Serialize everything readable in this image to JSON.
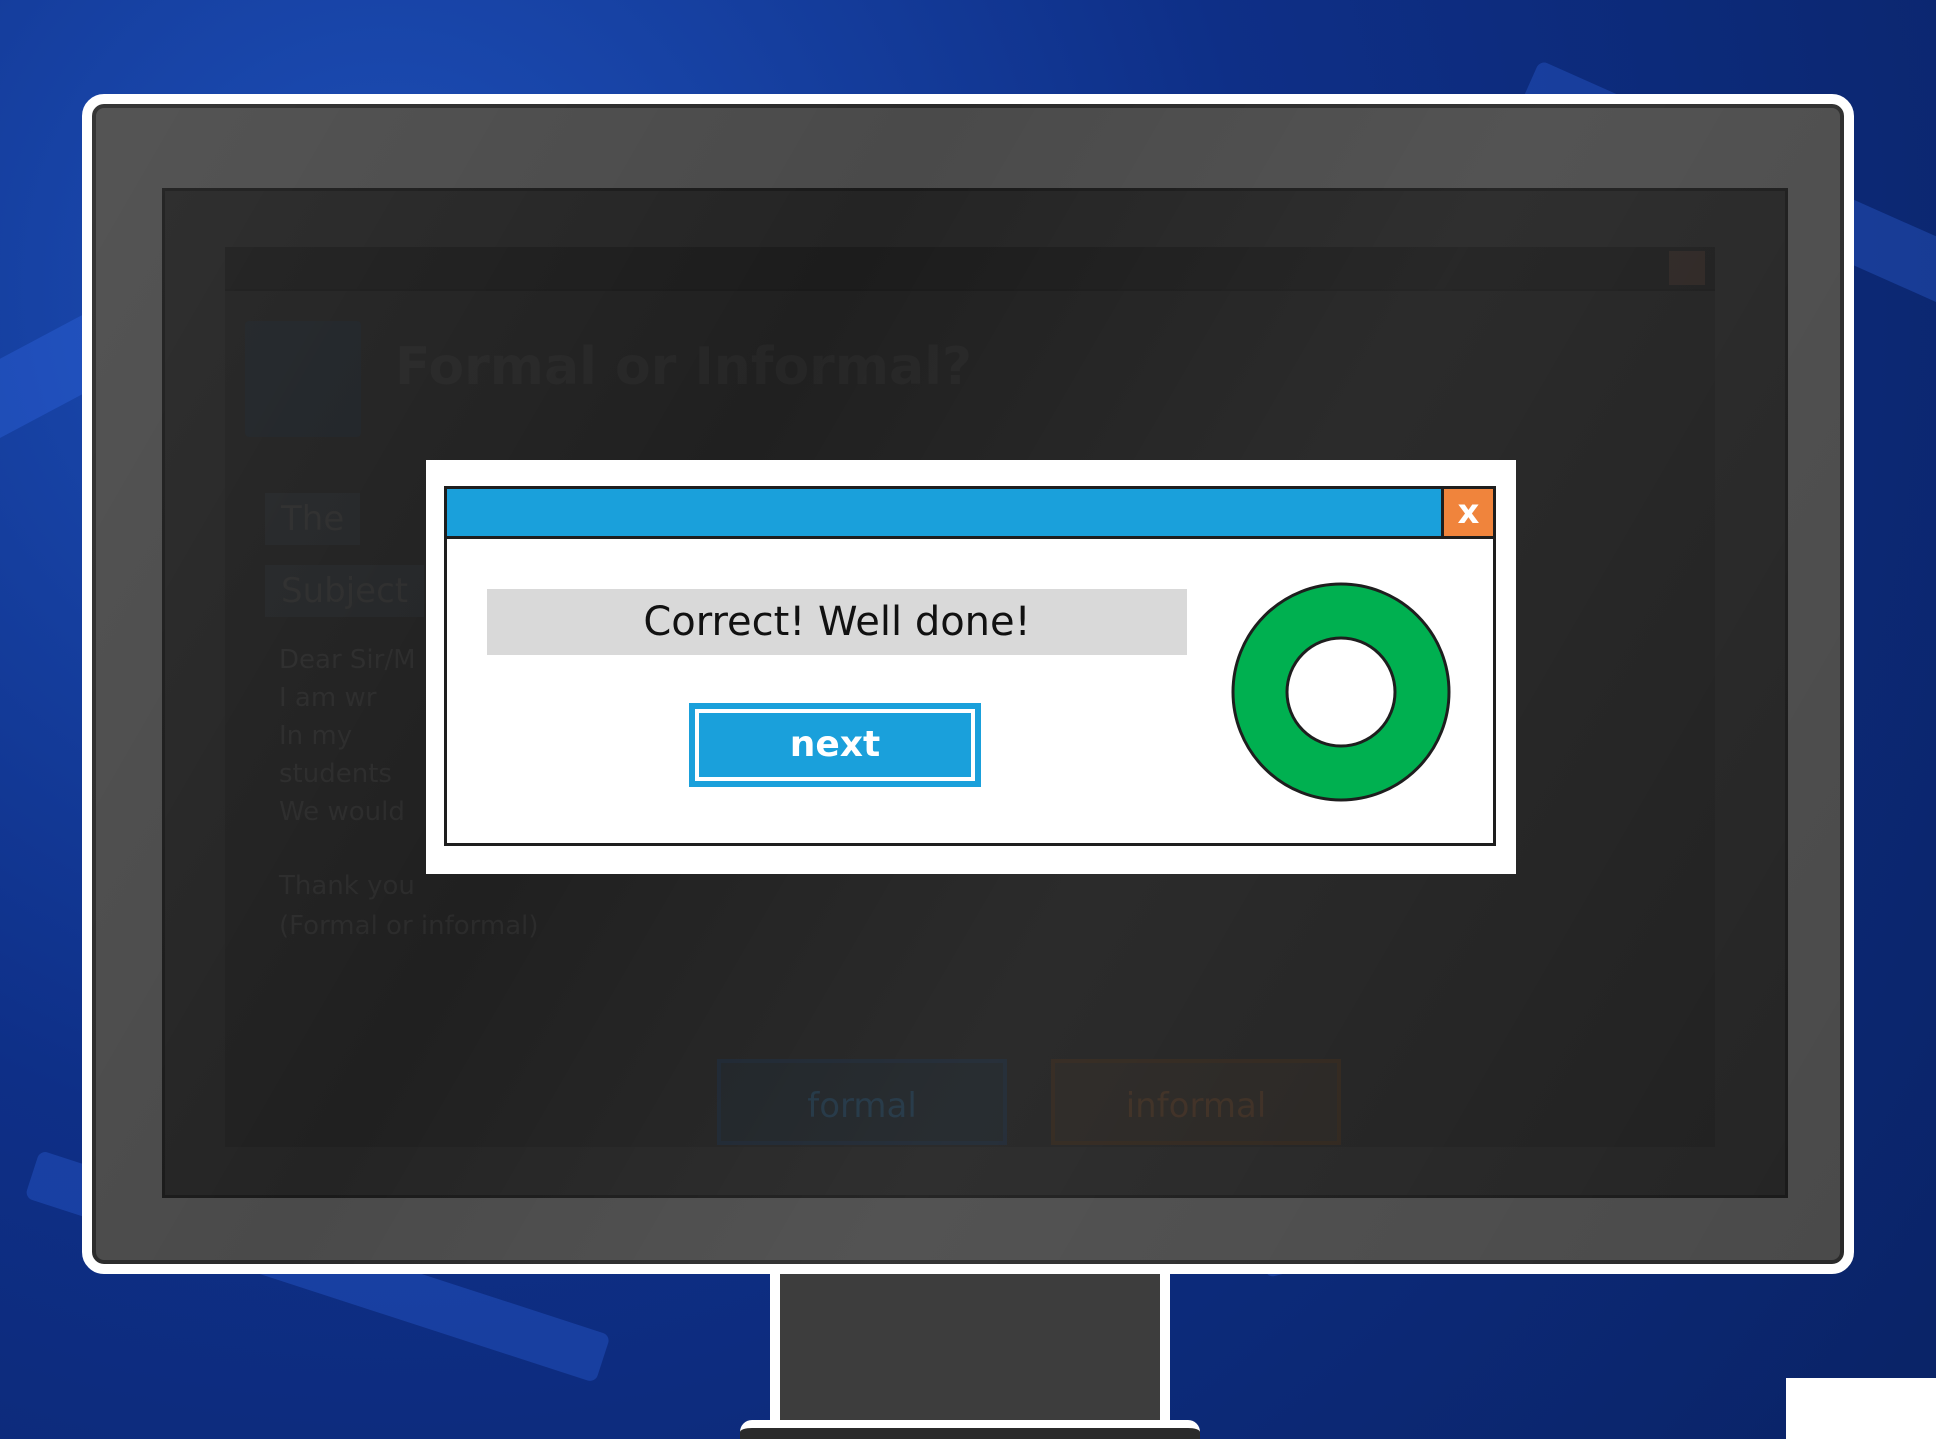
{
  "background_app": {
    "title": "Formal or Informal?",
    "tag_top": "The",
    "tag_bottom": "Subject",
    "lines": [
      "Dear Sir/M",
      "I am wr",
      "In my",
      "students",
      "We would"
    ],
    "lower_lines": [
      "Thank you",
      "(Formal or informal)"
    ],
    "formal_label": "formal",
    "informal_label": "informal"
  },
  "dialog": {
    "close_label": "x",
    "message": "Correct! Well done!",
    "next_label": "next",
    "result_icon": "green-ring-correct-icon"
  },
  "colors": {
    "titlebar": "#1aa0db",
    "close": "#f0843c",
    "ring": "#00b050",
    "message_bg": "#d9d9d9"
  }
}
